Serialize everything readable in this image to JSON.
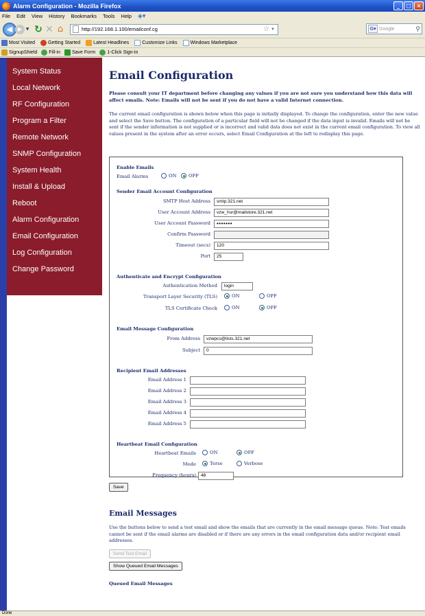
{
  "window": {
    "title": "Alarm Configuration - Mozilla Firefox"
  },
  "menu": [
    "File",
    "Edit",
    "View",
    "History",
    "Bookmarks",
    "Tools",
    "Help"
  ],
  "nav": {
    "url": "http://192.168.1.100/emailconf.cg",
    "search_placeholder": "Google"
  },
  "bookmarks": [
    "Most Visited",
    "Getting Started",
    "Latest Headlines",
    "Customize Links",
    "Windows Marketplace"
  ],
  "toolbar2": [
    "SignupShield",
    "Fill-in",
    "Save Form",
    "1-Click Sign-in"
  ],
  "sidebar": {
    "items": [
      "System Status",
      "Local Network",
      "RF Configuration",
      "Program a Filter",
      "Remote Network",
      "SNMP Configuration",
      "System Health",
      "Install & Upload",
      "Reboot",
      "Alarm Configuration",
      "Email Configuration",
      "Log Configuration",
      "Change Password"
    ]
  },
  "page": {
    "title": "Email Configuration",
    "warning": "Please consult your IT department before changing any values if you are not sure you understand how this data will affect emails.  Note: Emails will not be sent if you do not have a valid Internet connection.",
    "intro": "The current email configuration is shown below when this page is initially displayed. To change the configuration, enter the new value and select the Save button. The configuration of a particular field will not be changed if the data input is invalid. Emails will not be sent if the sender information is not supplied or is incorrect and valid data does not exist in the current email configuration. To view all values present in the system after an error occurs, select Email Configuration at the left to redisplay this page."
  },
  "enable": {
    "title": "Enable Emails",
    "label": "Email Alarms",
    "on": "ON",
    "off": "OFF",
    "selected": "OFF"
  },
  "sender": {
    "title": "Sender Email Account Configuration",
    "smtp_label": "SMTP Host Address",
    "smtp_value": "smtp.321.net",
    "user_label": "User Account Address",
    "user_value": "vzw_hsr@mailstore.321.net",
    "pw_label": "User Account Password",
    "pw_value": "•••••••",
    "confirm_label": "Confirm Password",
    "confirm_value": "",
    "timeout_label": "Timeout (secs)",
    "timeout_value": "120",
    "port_label": "Port",
    "port_value": "25"
  },
  "auth": {
    "title": "Authenticate and Encrypt Configuration",
    "method_label": "Authentication Method",
    "method_value": "login",
    "tls_label": "Transport Layer Security (TLS)",
    "tls_on": "ON",
    "tls_off": "OFF",
    "tls_selected": "ON",
    "cert_label": "TLS Certificate Check",
    "cert_on": "ON",
    "cert_off": "OFF",
    "cert_selected": "OFF"
  },
  "message": {
    "title": "Email Message Configuration",
    "from_label": "From Address",
    "from_value": "vzwpcs@lists.321.net",
    "subject_label": "Subject",
    "subject_value": "0"
  },
  "recipients": {
    "title": "Recipient Email Addresses",
    "labels": [
      "Email Address 1",
      "Email Address 2",
      "Email Address 3",
      "Email Address 4",
      "Email Address 5"
    ],
    "values": [
      "",
      "",
      "",
      "",
      ""
    ]
  },
  "heartbeat": {
    "title": "Heartbeat Email Configuration",
    "emails_label": "Heartbeat Emails",
    "emails_on": "ON",
    "emails_off": "OFF",
    "emails_selected": "OFF",
    "mode_label": "Mode",
    "mode_terse": "Terse",
    "mode_verbose": "Verbose",
    "mode_selected": "Terse",
    "freq_label": "Frequency (hours)",
    "freq_value": "48"
  },
  "save_label": "Save",
  "messages": {
    "title": "Email Messages",
    "text": "Use the buttons below to send a test email and show the emails that are currently in the email message queue. Note: Test emails cannot be sent if the email alarms are disabled or if there are any errors in the email configuration data and/or recipient email addresses.",
    "send_test": "Send Test Email",
    "show_queued": "Show Queued Email Messages",
    "queued_title": "Queued Email Messages"
  },
  "status": "Done"
}
